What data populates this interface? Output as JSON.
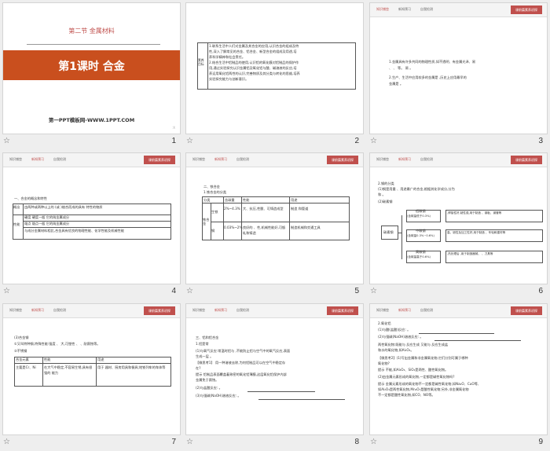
{
  "slides": [
    {
      "num": "1",
      "section": "第二节  金属材料",
      "lesson": "第1课时  合金",
      "footer_brand": "第一PPT模板网-WWW.1PPT.COM",
      "corner": "ℛ"
    },
    {
      "num": "2",
      "side_label": "素养目标",
      "lines": [
        "1.联系生活中人们对金属及其合金的应用,认识合金的组成及特",
        "性,深入了解常见的合金、铝合金、新型合金的组成及用途,培",
        "养科学精神和社会责任。",
        "2.结合生活中铝制品的使用,认识铝的氧化膜对铝制品的保护作",
        "用,通过实验探究认识金属铝及氧化铝与酸、碱溶液的反应,培",
        "养运用氧化铝两性的认识,完善物质及其分类与转化的思维,培养",
        "实验探究能力与创新意识。"
      ]
    },
    {
      "num": "3",
      "ribbon": "课前篇素养初探",
      "tabs": [
        "知识铺垫",
        "新知预习",
        "自我检测"
      ],
      "lines": [
        "1.金属具有许多共同的物理性质,如不透明、有金属光泽、易",
        "、 、 等。 易 。",
        "2.生产、生活中应用较多的金属是 ,历史上应用最早的",
        "金属是 。"
      ]
    },
    {
      "num": "4",
      "ribbon": "课前篇素养初探",
      "tabs": [
        "知识铺垫",
        "新知预习",
        "自我检测"
      ],
      "heading": "一、合金的概念和特性",
      "rows": [
        [
          "概念",
          "由两种或两种以上的 (或 )熔合而成的具有 特性的物质"
        ],
        [
          "性能",
          "硬度 硬度一般 它的纯金属成分"
        ],
        [
          "",
          "熔点 熔点一般 它的纯金属成分"
        ],
        [
          "",
          "与成分金属材料相比,合金具有优良的物理性能、化学性能及机械性能"
        ]
      ]
    },
    {
      "num": "5",
      "ribbon": "课前篇素养初探",
      "tabs": [
        "知识铺垫",
        "新知预习",
        "自我检测"
      ],
      "heading": "二、铁合金",
      "sub": "1.铁合金的分类",
      "cols": [
        "分类",
        "含碳量",
        "性能",
        "用途"
      ],
      "rows": [
        [
          "生铁",
          "2%~4.3%",
          "大、抗压,性脆、可铸造成型",
          "制造 和管道"
        ],
        [
          "钢",
          "0.03%~2%",
          "良好的 、性,机械性能好,可锻轧和铸造",
          "制造机械和交通工具"
        ]
      ],
      "left_label": "铁合金"
    },
    {
      "num": "6",
      "ribbon": "课前篇素养初探",
      "tabs": [
        "知识铺垫",
        "新知预习",
        "自我检测"
      ],
      "lines": [
        "2.钢的分类",
        "(1)钢是用量 、用途最广的合金,根据其化学成分,分为",
        "和 。",
        "(2)碳素钢"
      ],
      "root": "碳素钢",
      "branches": [
        [
          "低碳钢",
          "(含碳量低于0.3%)",
          ",焊接性好,韧性强,用于制造 、钢板、钢管等"
        ],
        [
          "中碳钢",
          "(含碳量0.3%~0.6%)",
          "高、韧性及加工性好,用于制造 、车轮和建材等"
        ],
        [
          "高碳钢",
          "(含碳量高于0.6%)",
          ",热处理后 ,用于制造器械、 、刀具等"
        ]
      ]
    },
    {
      "num": "7",
      "ribbon": "课前篇素养初探",
      "tabs": [
        "知识铺垫",
        "新知预习",
        "自我检测"
      ],
      "lines": [
        "(3)合金钢",
        "①又叫特种钢,特殊性能:强度 、 大,可塑性 、 、耐腐蚀等。",
        "②不锈钢"
      ],
      "table_head": [
        "合金元素",
        "性能",
        "用途"
      ],
      "table_row": [
        "主要是Cr、Ni",
        "在大气中稳定,不容易生锈,具有很强的 能力",
        "用于 器材、厨房用具和餐具;地铁列车的车体等"
      ]
    },
    {
      "num": "8",
      "ribbon": "课前篇素养初探",
      "tabs": [
        "知识铺垫",
        "新知预习",
        "自我检测"
      ],
      "lines": [
        "三、铝和铝合金",
        "1.铝是常",
        "(1)与氧气反应:常温时铝与 ,不能防止铝与空气中的氧气反应,表面",
        "生成一层 。",
        "【微思考1】 用一种溶液去除,为何铝制品可以在空气中稳定存",
        "在?",
        "提示 铝制品表面覆盖着致密的氧化铝薄膜,这层氧化铝保护内部",
        "金属免于腐蚀。",
        "(2)与盐酸反应: 。",
        "(3)与强碱(NaOH)溶液反应: 。"
      ]
    },
    {
      "num": "9",
      "ribbon": "课前篇素养初探",
      "tabs": [
        "知识铺垫",
        "新知预习",
        "自我检测"
      ],
      "lines": [
        "2.氧化铝",
        "(1)与酸(盐酸)反应: 。",
        "(2)与强碱(NaOH)溶液反应: 。",
        "两性氧化物:既能与 反应生成 又能与 反应生成盐",
        "和水的氧化物,如Al₂O₃。",
        "【微思考2】(1)写出金属和非金属氧化物,它们分别可属于哪种",
        "氧化物?",
        "提示 不能,如Al₂O₃、SiO₂是两性、酸性氧化物。",
        "(2)由金属元素形成的氧化物,一定都是碱性氧化物吗?",
        "提示 金属元素形成的氧化物不一定都是碱性氧化物,如Na₂O、CuO等,",
        "如Al₂O₃是两性氧化物,Mn₂O₇是酸性氧化物;另外,非金属氧化物",
        "不一定都是酸性氧化物,如CO、NO等。"
      ]
    }
  ]
}
